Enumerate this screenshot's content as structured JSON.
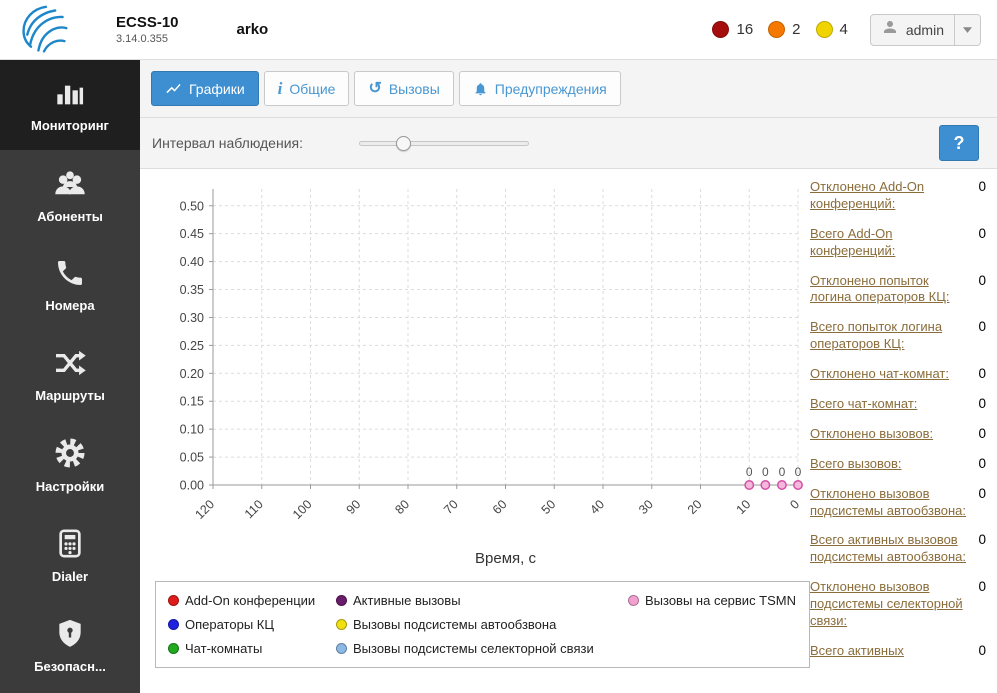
{
  "header": {
    "app_name": "ECSS-10",
    "version": "3.14.0.355",
    "system_name": "arko",
    "alarms": [
      {
        "level": "critical",
        "color": "#a50d0d",
        "count": "16"
      },
      {
        "level": "major",
        "color": "#f57900",
        "count": "2"
      },
      {
        "level": "minor",
        "color": "#f0d400",
        "count": "4"
      }
    ],
    "user_name": "admin"
  },
  "sidebar": {
    "items": [
      {
        "label": "Мониторинг",
        "icon": "bar-chart"
      },
      {
        "label": "Абоненты",
        "icon": "users"
      },
      {
        "label": "Номера",
        "icon": "phone"
      },
      {
        "label": "Маршруты",
        "icon": "shuffle"
      },
      {
        "label": "Настройки",
        "icon": "gear"
      },
      {
        "label": "Dialer",
        "icon": "keypad"
      },
      {
        "label": "Безопасн...",
        "icon": "shield"
      }
    ]
  },
  "tabs": {
    "items": [
      {
        "label": "Графики",
        "icon": "line-chart"
      },
      {
        "label": "Общие",
        "icon": "info"
      },
      {
        "label": "Вызовы",
        "icon": "history"
      },
      {
        "label": "Предупреждения",
        "icon": "bell"
      }
    ]
  },
  "icons": {
    "info_glyph": "i",
    "history_glyph": "↺"
  },
  "controls": {
    "interval_label": "Интервал наблюдения:",
    "slider_percent": 26,
    "help_label": "?"
  },
  "chart_data": {
    "type": "line",
    "title": "",
    "xlabel": "Время, с",
    "ylabel": "",
    "xlim": [
      120,
      0
    ],
    "x_axis_reversed": true,
    "x_ticks": [
      120,
      110,
      100,
      90,
      80,
      70,
      60,
      50,
      40,
      30,
      20,
      10,
      0
    ],
    "ylim": [
      0,
      0.53
    ],
    "y_ticks": [
      0,
      0.05,
      0.1,
      0.15,
      0.2,
      0.25,
      0.3,
      0.35,
      0.4,
      0.45,
      0.5
    ],
    "grid": true,
    "legend_position": "bottom",
    "series": [
      {
        "name": "Вызовы на сервис TSMN",
        "color": "#d44fa4",
        "fill": "#f5b8dd",
        "x": [
          10,
          6.7,
          3.3,
          0
        ],
        "y": [
          0,
          0,
          0,
          0
        ],
        "point_labels": [
          "0",
          "0",
          "0",
          "0"
        ]
      }
    ],
    "legend": [
      {
        "label": "Add-On конференции",
        "color": "#e01b1b"
      },
      {
        "label": "Операторы КЦ",
        "color": "#2020e0"
      },
      {
        "label": "Чат-комнаты",
        "color": "#1faa1f"
      },
      {
        "label": "Активные вызовы",
        "color": "#6b1b6b"
      },
      {
        "label": "Вызовы подсистемы автообзвона",
        "color": "#f0e010"
      },
      {
        "label": "Вызовы подсистемы селекторной связи",
        "color": "#8cb8e6"
      },
      {
        "label": "Вызовы на сервис TSMN",
        "color": "#f2a0d0"
      }
    ]
  },
  "stats": {
    "items": [
      {
        "label": "Отклонено Add-On конференций:",
        "value": "0"
      },
      {
        "label": "Всего Add-On конференций:",
        "value": "0"
      },
      {
        "label": "Отклонено попыток логина операторов КЦ:",
        "value": "0"
      },
      {
        "label": "Всего попыток логина операторов КЦ:",
        "value": "0"
      },
      {
        "label": "Отклонено чат-комнат:",
        "value": "0"
      },
      {
        "label": "Всего чат-комнат:",
        "value": "0"
      },
      {
        "label": "Отклонено вызовов:",
        "value": "0"
      },
      {
        "label": "Всего вызовов:",
        "value": "0"
      },
      {
        "label": "Отклонено вызовов подсистемы автообзвона:",
        "value": "0"
      },
      {
        "label": "Всего активных вызовов подсистемы автообзвона:",
        "value": "0"
      },
      {
        "label": "Отклонено вызовов подсистемы селекторной связи:",
        "value": "0"
      },
      {
        "label": "Всего активных",
        "value": "0"
      }
    ]
  }
}
